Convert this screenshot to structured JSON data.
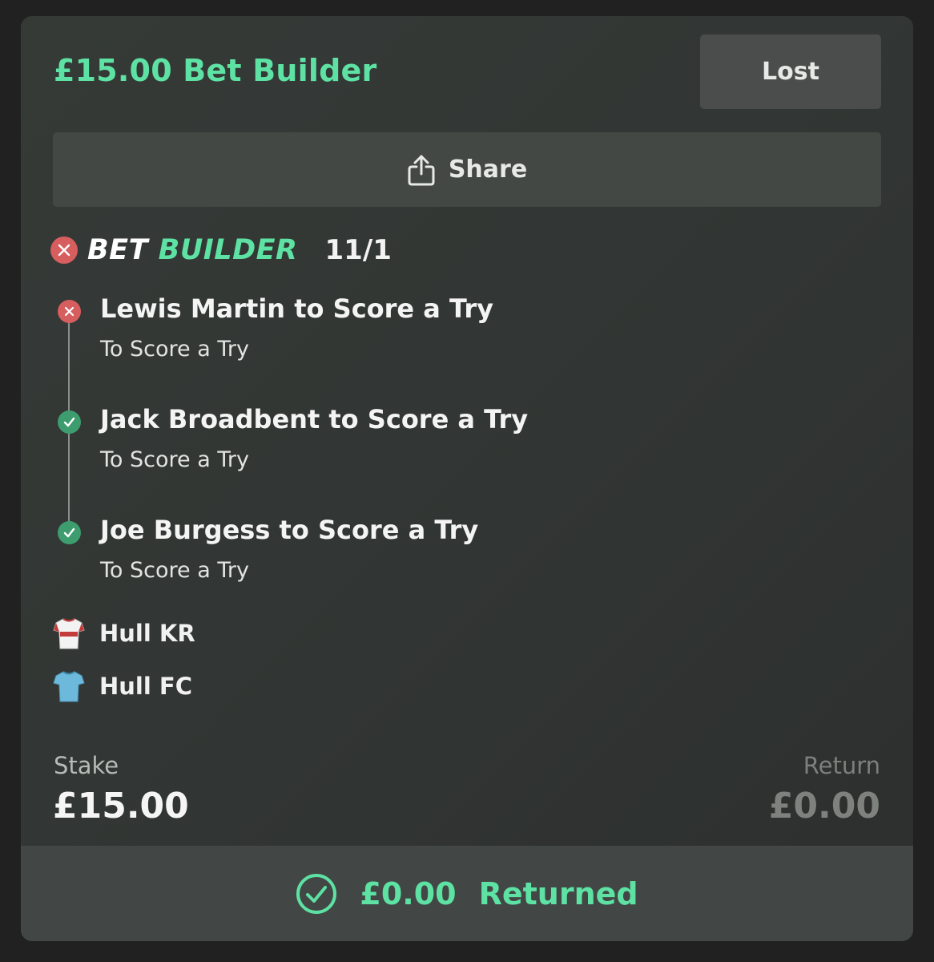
{
  "header": {
    "title": "£15.00 Bet Builder",
    "status": "Lost"
  },
  "share": {
    "label": "Share",
    "icon": "share-icon"
  },
  "bet_builder": {
    "logo_part1": "BET",
    "logo_part2": "BUILDER",
    "odds": "11/1",
    "status_icon": "close-icon",
    "status": "lost"
  },
  "legs": [
    {
      "title": "Lewis Martin to Score a Try",
      "subtitle": "To Score a Try",
      "result": "lost"
    },
    {
      "title": "Jack Broadbent to Score a Try",
      "subtitle": "To Score a Try",
      "result": "won"
    },
    {
      "title": "Joe Burgess to Score a Try",
      "subtitle": "To Score a Try",
      "result": "won"
    }
  ],
  "teams": [
    {
      "name": "Hull KR",
      "icon": "shirt-white-red-icon"
    },
    {
      "name": "Hull FC",
      "icon": "shirt-blue-icon"
    }
  ],
  "summary": {
    "stake_label": "Stake",
    "stake_value": "£15.00",
    "return_label": "Return",
    "return_value": "£0.00"
  },
  "footer": {
    "amount": "£0.00",
    "text": "Returned",
    "icon": "check-circle-icon"
  },
  "colors": {
    "accent": "#5ee2a4",
    "lost": "#d75e5e",
    "won": "#3e9d6f",
    "background": "#313533"
  }
}
